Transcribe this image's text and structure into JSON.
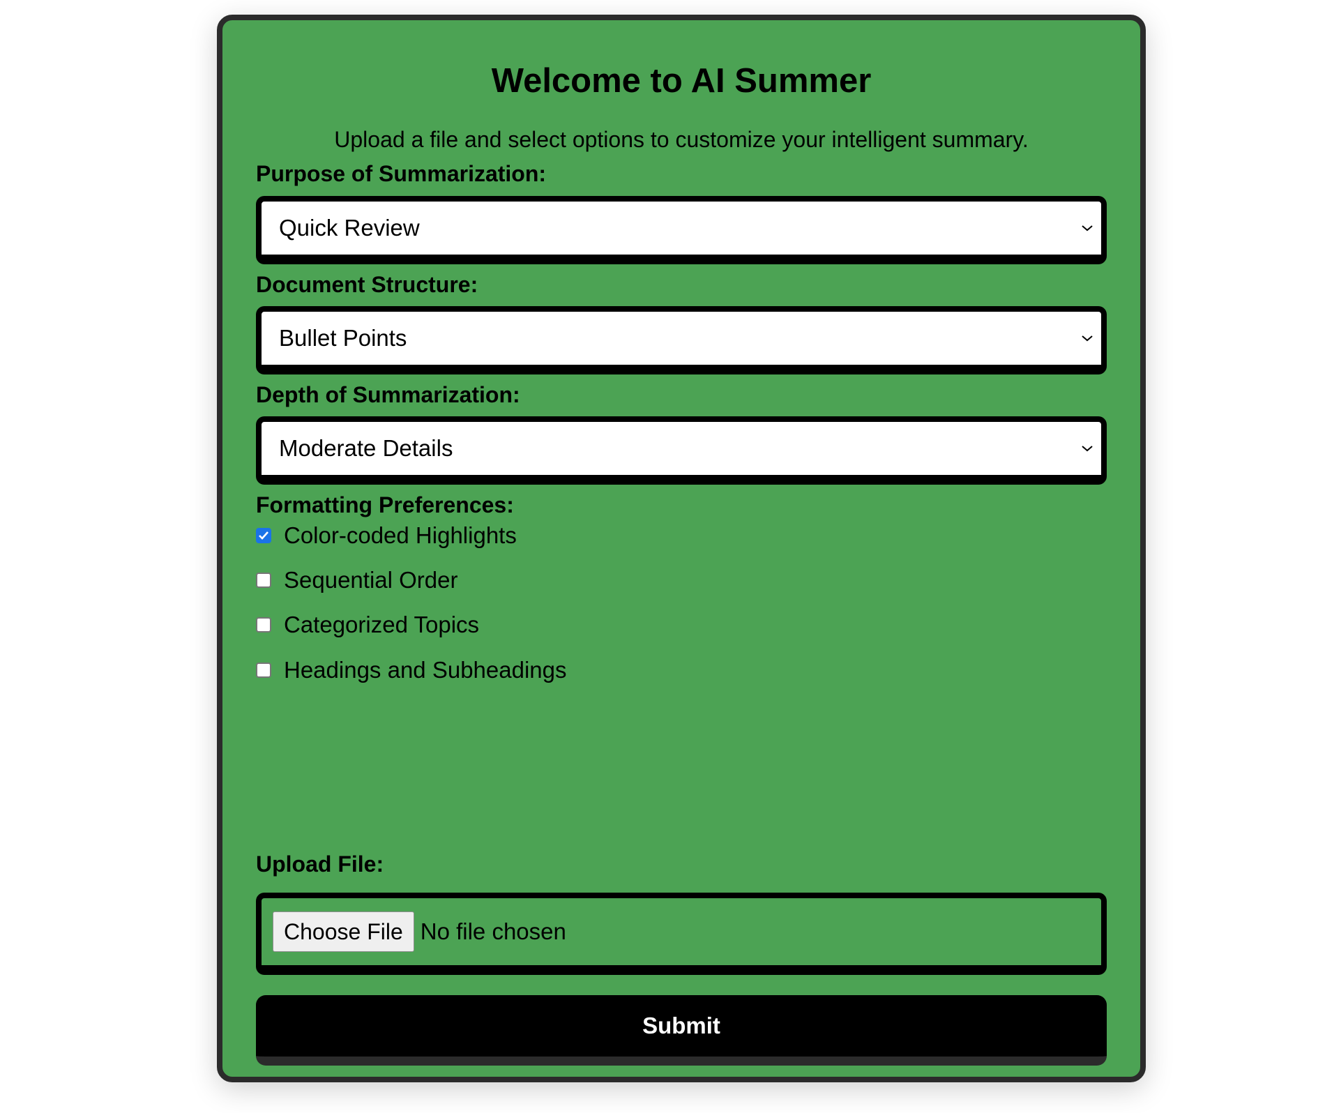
{
  "header": {
    "title": "Welcome to AI Summer",
    "subtitle": "Upload a file and select options to customize your intelligent summary."
  },
  "purpose": {
    "label": "Purpose of Summarization:",
    "selected": "Quick Review"
  },
  "structure": {
    "label": "Document Structure:",
    "selected": "Bullet Points"
  },
  "depth": {
    "label": "Depth of Summarization:",
    "selected": "Moderate Details"
  },
  "formatting": {
    "label": "Formatting Preferences:",
    "options": [
      {
        "label": "Color-coded Highlights",
        "checked": true
      },
      {
        "label": "Sequential Order",
        "checked": false
      },
      {
        "label": "Categorized Topics",
        "checked": false
      },
      {
        "label": "Headings and Subheadings",
        "checked": false
      }
    ]
  },
  "upload": {
    "label": "Upload File:",
    "button_label": "Choose File",
    "status": "No file chosen"
  },
  "submit": {
    "label": "Submit"
  },
  "colors": {
    "card_background": "#4ca354",
    "card_border": "#2b2b2b",
    "checkbox_checked": "#1a73e8",
    "submit_background": "#000000"
  }
}
